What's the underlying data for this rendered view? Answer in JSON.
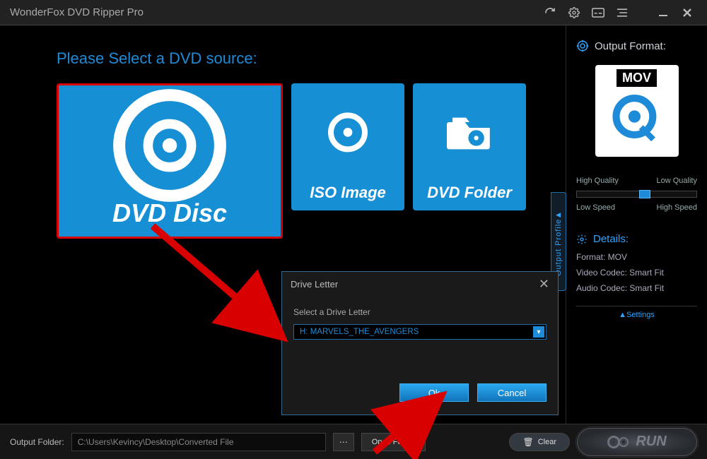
{
  "titlebar": {
    "title": "WonderFox DVD Ripper Pro"
  },
  "source": {
    "prompt": "Please Select a DVD source:",
    "dvd_disc": "DVD Disc",
    "iso_image": "ISO Image",
    "dvd_folder": "DVD Folder"
  },
  "profile_tab": "Output Profile",
  "output": {
    "heading": "Output Format:",
    "format_badge": "MOV",
    "quality_high": "High Quality",
    "quality_low": "Low Quality",
    "speed_low": "Low Speed",
    "speed_high": "High Speed"
  },
  "details": {
    "heading": "Details:",
    "format": "Format: MOV",
    "video": "Video Codec: Smart Fit",
    "audio": "Audio Codec: Smart Fit",
    "settings": "Settings"
  },
  "bottom": {
    "label": "Output Folder:",
    "path": "C:\\Users\\Kevincy\\Desktop\\Converted File",
    "open": "Open Folder",
    "clear": "Clear",
    "run": "RUN"
  },
  "dialog": {
    "title": "Drive Letter",
    "label": "Select a Drive Letter",
    "value": "H:  MARVELS_THE_AVENGERS",
    "ok": "Ok",
    "cancel": "Cancel"
  }
}
